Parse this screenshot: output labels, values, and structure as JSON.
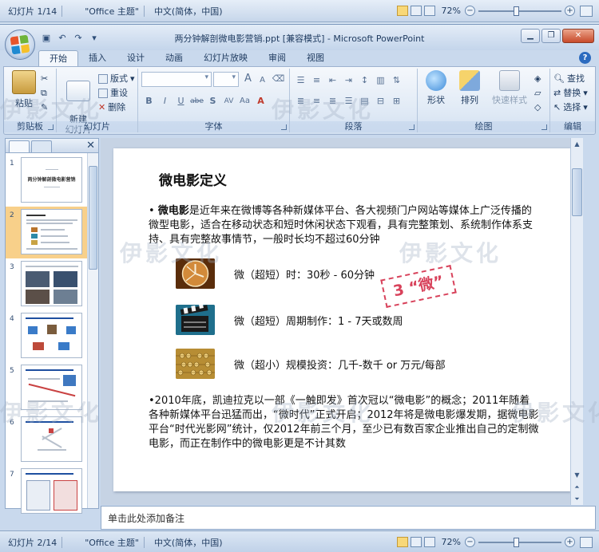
{
  "background_window": {
    "status": {
      "slide_counter": "幻灯片 1/14",
      "theme": "\"Office 主题\"",
      "language": "中文(简体，中国)",
      "zoom": "72%"
    }
  },
  "window": {
    "title": "两分钟解剖微电影营销.ppt [兼容模式] - Microsoft PowerPoint",
    "tabs": [
      "开始",
      "插入",
      "设计",
      "动画",
      "幻灯片放映",
      "审阅",
      "视图"
    ],
    "help_icon_label": "?"
  },
  "ribbon": {
    "clipboard": {
      "label": "剪贴板",
      "paste": "粘贴"
    },
    "slides": {
      "label": "幻灯片",
      "new_slide": "新建\n幻灯片",
      "layout": "版式",
      "reset": "重设",
      "delete": "删除"
    },
    "font": {
      "label": "字体",
      "bold": "B",
      "italic": "I",
      "underline": "U",
      "strike": "abe",
      "shadow": "S",
      "spacing": "AV",
      "case": "Aa",
      "grow": "A",
      "shrink": "A"
    },
    "paragraph": {
      "label": "段落"
    },
    "drawing": {
      "label": "绘图",
      "shapes": "形状",
      "arrange": "排列",
      "quick_styles": "快速样式"
    },
    "editing": {
      "label": "编辑",
      "find": "查找",
      "replace": "替换",
      "select": "选择"
    }
  },
  "thumbnails": [
    {
      "num": "1",
      "title": "两分钟解剖微电影营销"
    },
    {
      "num": "2",
      "selected": true
    },
    {
      "num": "3"
    },
    {
      "num": "4"
    },
    {
      "num": "5"
    },
    {
      "num": "6"
    },
    {
      "num": "7"
    }
  ],
  "slide": {
    "title": "微电影定义",
    "intro_bullet": "•",
    "intro_bold": "微电影",
    "intro_text": "是近年来在微博等各种新媒体平台、各大视频门户网站等媒体上广泛传播的微型电影，适合在移动状态和短时休闲状态下观看，具有完整策划、系统制作体系支持、具有完整故事情节，一般时长均不超过60分钟",
    "items": [
      {
        "text": "微（超短）时：30秒 - 60分钟",
        "icon": "clock-icon"
      },
      {
        "text": "微（超短）周期制作：1 - 7天或数周",
        "icon": "clapperboard-icon"
      },
      {
        "text": "微（超小）规模投资：几千-数千  or 万元/每部",
        "icon": "abacus-icon"
      }
    ],
    "stamp": "3 “微”",
    "history_text": "•2010年底，凯迪拉克以一部《一触即发》首次冠以“微电影”的概念；2011年随着各种新媒体平台迅猛而出，“微时代”正式开启；2012年将是微电影爆发期，据微电影平台“时代光影网”统计，仅2012年前三个月，至少已有数百家企业推出自己的定制微电影，而正在制作中的微电影更是不计其数"
  },
  "notes_placeholder": "单击此处添加备注",
  "status": {
    "slide_counter": "幻灯片 2/14",
    "theme": "\"Office 主题\"",
    "language": "中文(简体，中国)",
    "zoom": "72%"
  },
  "watermark": "伊影文化",
  "colors": {
    "ribbon_bg": "#dfe9f5",
    "selected_thumb": "#f8d08a",
    "stamp": "#d8425b"
  }
}
